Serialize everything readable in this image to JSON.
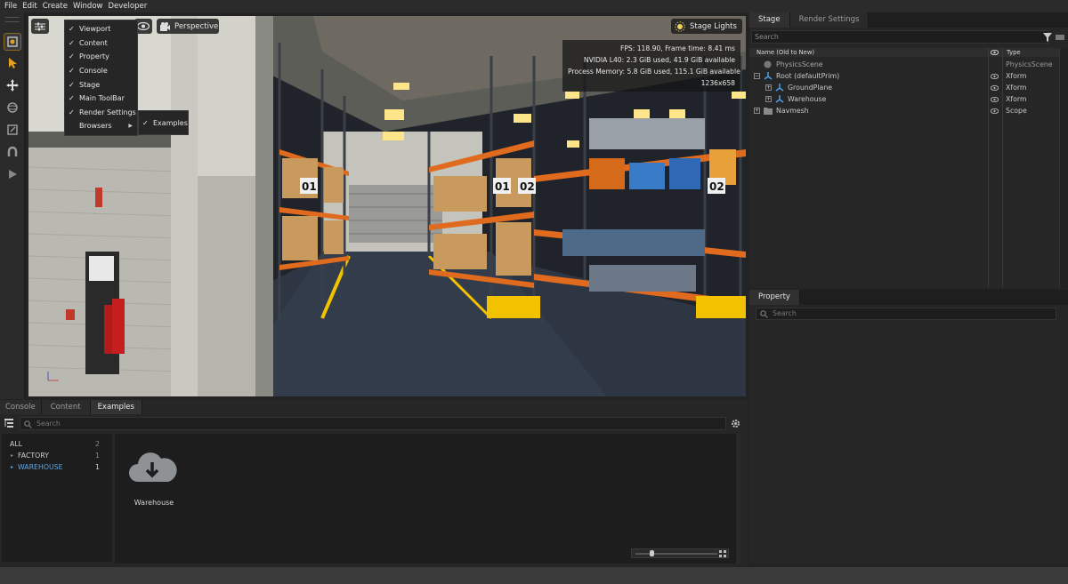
{
  "menubar": {
    "items": [
      "File",
      "Edit",
      "Create",
      "Window",
      "Developer"
    ]
  },
  "viewport": {
    "camera": "Perspective",
    "lights": "Stage Lights",
    "stats": [
      "FPS: 118.90, Frame time: 8.41 ms",
      "NVIDIA L40: 2.3 GiB used, 41.9 GiB available",
      "Process Memory: 5.8 GiB used, 115.1 GiB available",
      "1236x658"
    ],
    "rack_labels": [
      "01",
      "01",
      "02",
      "02"
    ]
  },
  "window_menu": {
    "items": [
      {
        "label": "Viewport",
        "checked": true
      },
      {
        "label": "Content",
        "checked": true
      },
      {
        "label": "Property",
        "checked": true
      },
      {
        "label": "Console",
        "checked": true
      },
      {
        "label": "Stage",
        "checked": true
      },
      {
        "label": "Main ToolBar",
        "checked": true
      },
      {
        "label": "Render Settings",
        "checked": true
      },
      {
        "label": "Browsers",
        "checked": false,
        "submenu": true
      }
    ],
    "submenu": {
      "label": "Examples",
      "checked": true
    }
  },
  "stage": {
    "tabs": [
      "Stage",
      "Render Settings"
    ],
    "search_placeholder": "Search",
    "col_name": "Name (Old to New)",
    "col_type": "Type",
    "rows": [
      {
        "name": "PhysicsScene",
        "type": "PhysicsScene",
        "indent": 0,
        "expander": false,
        "eye": false
      },
      {
        "name": "Root (defaultPrim)",
        "type": "Xform",
        "indent": 0,
        "expander": true,
        "eye": true
      },
      {
        "name": "GroundPlane",
        "type": "Xform",
        "indent": 1,
        "expander": true,
        "eye": true
      },
      {
        "name": "Warehouse",
        "type": "Xform",
        "indent": 1,
        "expander": true,
        "eye": true
      },
      {
        "name": "Navmesh",
        "type": "Scope",
        "indent": 0,
        "expander": true,
        "eye": true
      }
    ]
  },
  "property": {
    "tab": "Property",
    "search_placeholder": "Search"
  },
  "bottom": {
    "tabs": [
      "Console",
      "Content",
      "Examples"
    ],
    "active_tab": "Examples",
    "search_placeholder": "Search",
    "categories": [
      {
        "name": "ALL",
        "count": "2"
      },
      {
        "name": "FACTORY",
        "count": "1"
      },
      {
        "name": "WAREHOUSE",
        "count": "1"
      }
    ],
    "items": [
      {
        "label": "Warehouse"
      }
    ]
  },
  "colors": {
    "accent": "#4a9ee8",
    "selected": "#5aa7e6",
    "safety_yellow": "#f2c200",
    "rack_orange": "#e06a1e"
  }
}
